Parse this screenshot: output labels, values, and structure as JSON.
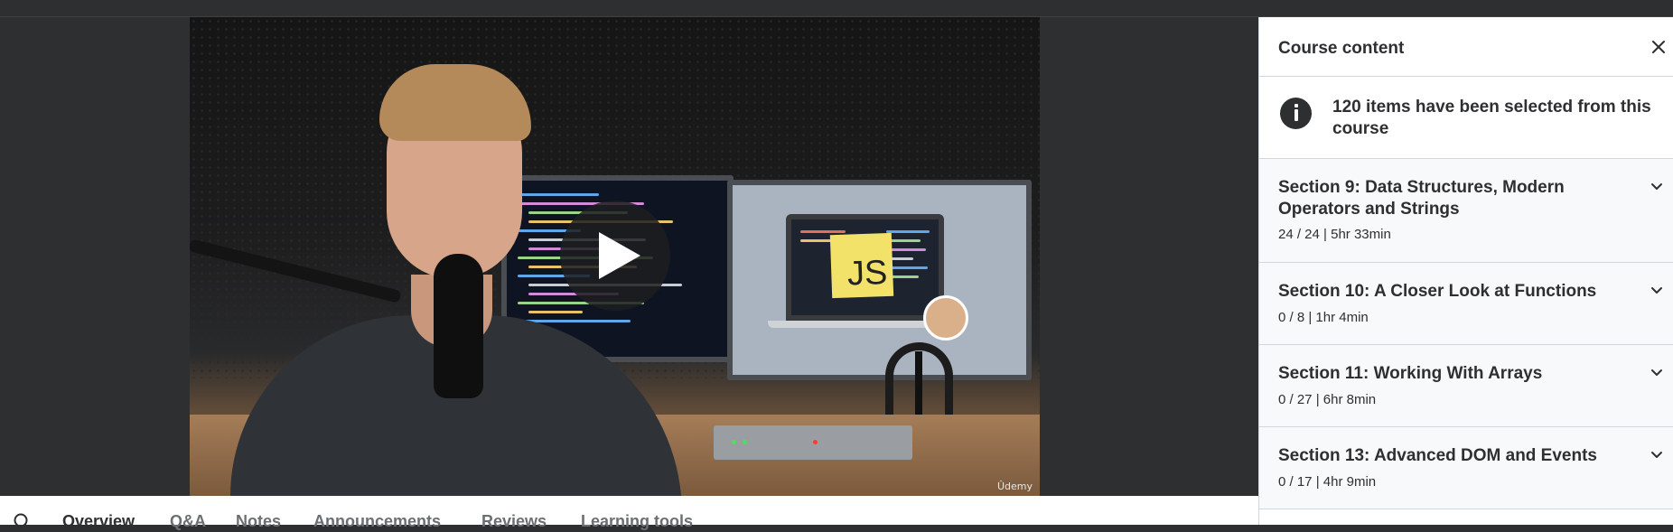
{
  "video": {
    "watermark": "Ûdemy",
    "note_text": "JS"
  },
  "tabs": [
    {
      "label": "Overview",
      "active": true
    },
    {
      "label": "Q&A",
      "active": false
    },
    {
      "label": "Notes",
      "active": false
    },
    {
      "label": "Announcements",
      "active": false
    },
    {
      "label": "Reviews",
      "active": false
    },
    {
      "label": "Learning tools",
      "active": false
    }
  ],
  "panel": {
    "title": "Course content",
    "notice": "120 items have been selected from this course",
    "sections": [
      {
        "title": "Section 9: Data Structures, Modern Operators and Strings",
        "meta": "24 / 24 | 5hr 33min"
      },
      {
        "title": "Section 10: A Closer Look at Functions",
        "meta": "0 / 8 | 1hr 4min"
      },
      {
        "title": "Section 11: Working With Arrays",
        "meta": "0 / 27 | 6hr 8min"
      },
      {
        "title": "Section 13: Advanced DOM and Events",
        "meta": "0 / 17 | 4hr 9min"
      }
    ]
  },
  "icons": {
    "play": "play-icon",
    "close": "close-icon",
    "info": "info-icon",
    "chevron": "chevron-down-icon",
    "search": "search-icon"
  },
  "colors": {
    "background": "#2d2f31",
    "text": "#2d2f31",
    "muted": "#6a6f73",
    "panel_bg": "#ffffff",
    "section_bg": "#f7f9fa",
    "border": "#d1d7dc"
  }
}
